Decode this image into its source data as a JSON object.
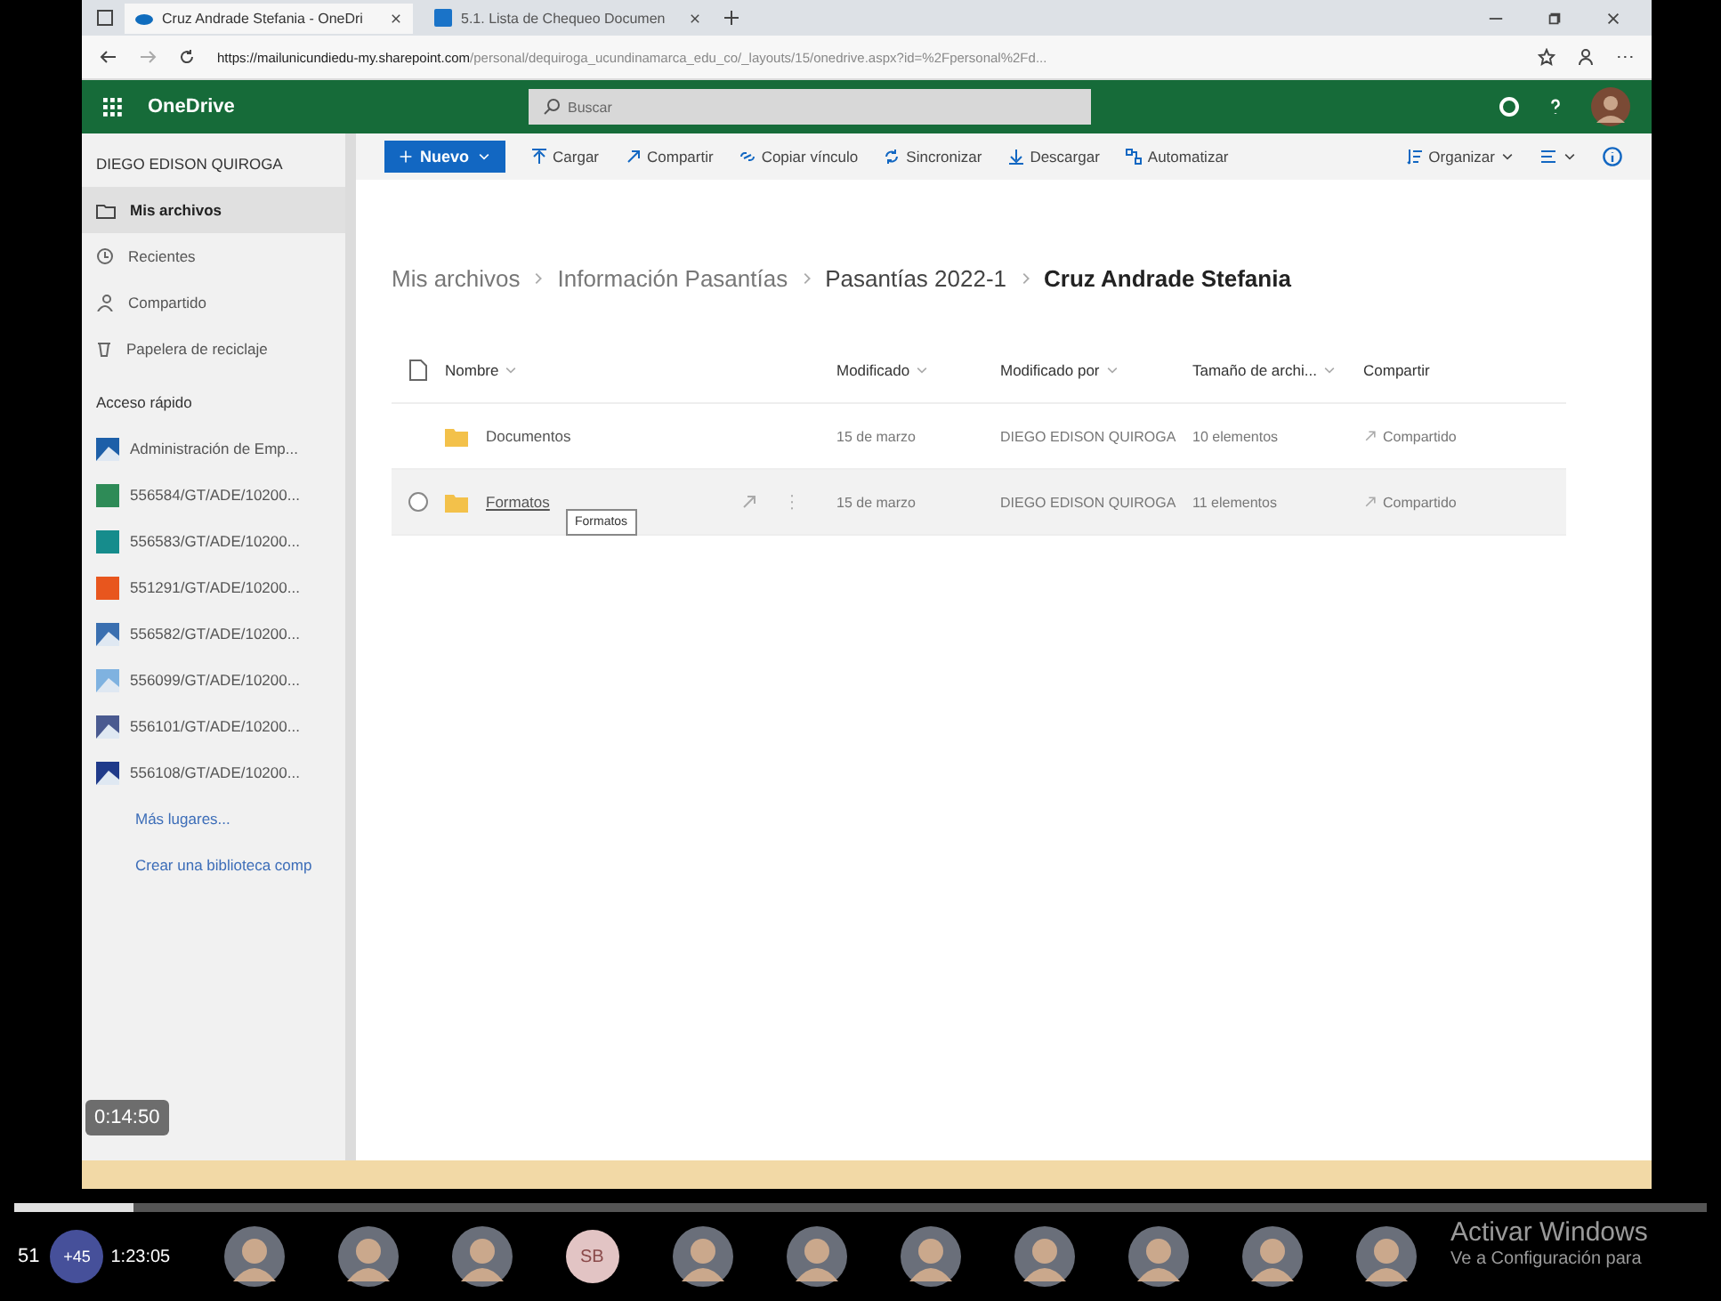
{
  "browser": {
    "tabs": [
      {
        "title": "Cruz Andrade Stefania - OneDri",
        "kind": "onedrive",
        "selected": true
      },
      {
        "title": "5.1. Lista de Chequeo Documen",
        "kind": "doc",
        "selected": false
      }
    ],
    "url_host": "https://mailunicundiedu-my.sharepoint.com",
    "url_path": "/personal/dequiroga_ucundinamarca_edu_co/_layouts/15/onedrive.aspx?id=%2Fpersonal%2Fd..."
  },
  "app": {
    "name": "OneDrive",
    "search_placeholder": "Buscar"
  },
  "sidebar": {
    "user": "DIEGO EDISON QUIROGA",
    "nav": [
      {
        "label": "Mis archivos",
        "kind": "folder",
        "selected": true
      },
      {
        "label": "Recientes",
        "kind": "clock",
        "selected": false
      },
      {
        "label": "Compartido",
        "kind": "share",
        "selected": false
      },
      {
        "label": "Papelera de reciclaje",
        "kind": "trash",
        "selected": false
      }
    ],
    "quick_access_title": "Acceso rápido",
    "quick_access": [
      {
        "label": "Administración de Emp...",
        "kind": "image",
        "color": "#1d5fa8"
      },
      {
        "label": "556584/GT/ADE/10200...",
        "kind": "site",
        "color": "#2e8b57"
      },
      {
        "label": "556583/GT/ADE/10200...",
        "kind": "site",
        "color": "#168c8c"
      },
      {
        "label": "551291/GT/ADE/10200...",
        "kind": "site",
        "color": "#e8561e"
      },
      {
        "label": "556582/GT/ADE/10200...",
        "kind": "image",
        "color": "#3a6fb0"
      },
      {
        "label": "556099/GT/ADE/10200...",
        "kind": "image",
        "color": "#7fb2e0"
      },
      {
        "label": "556101/GT/ADE/10200...",
        "kind": "image",
        "color": "#4a5a90"
      },
      {
        "label": "556108/GT/ADE/10200...",
        "kind": "image",
        "color": "#1f3a8a"
      }
    ],
    "links": [
      "Más lugares...",
      "Crear una biblioteca comp"
    ]
  },
  "commands": [
    {
      "label": "Nuevo",
      "kind": "primary"
    },
    {
      "label": "Cargar",
      "kind": "upload"
    },
    {
      "label": "Compartir",
      "kind": "share"
    },
    {
      "label": "Copiar vínculo",
      "kind": "link"
    },
    {
      "label": "Sincronizar",
      "kind": "sync"
    },
    {
      "label": "Descargar",
      "kind": "download"
    },
    {
      "label": "Automatizar",
      "kind": "flow"
    }
  ],
  "right_commands": [
    {
      "label": "Organizar",
      "kind": "sort"
    },
    {
      "kind": "view"
    }
  ],
  "breadcrumb": [
    "Mis archivos",
    "Información Pasantías",
    "Pasantías 2022-1",
    "Cruz Andrade Stefania"
  ],
  "table": {
    "columns": [
      "Nombre",
      "Modificado",
      "Modificado por",
      "Tamaño de archi...",
      "Compartir"
    ],
    "rows": [
      {
        "name": "Documentos",
        "modified": "15 de marzo",
        "modified_by": "DIEGO EDISON QUIROGA",
        "size": "10 elementos",
        "sharing": "Compartido",
        "hovered": false
      },
      {
        "name": "Formatos",
        "modified": "15 de marzo",
        "modified_by": "DIEGO EDISON QUIROGA",
        "size": "11 elementos",
        "sharing": "Compartido",
        "hovered": true
      }
    ]
  },
  "tooltip": "Formatos",
  "player": {
    "time_tooltip": "0:14:50",
    "elapsed": "1:23:05",
    "level": 0.07
  },
  "call": {
    "count": "51",
    "extra": "+45",
    "participants": [
      {
        "kind": "photo"
      },
      {
        "kind": "photo"
      },
      {
        "kind": "photo"
      },
      {
        "kind": "initials",
        "initials": "SB"
      },
      {
        "kind": "photo"
      },
      {
        "kind": "photo"
      },
      {
        "kind": "photo"
      },
      {
        "kind": "photo"
      },
      {
        "kind": "photo"
      },
      {
        "kind": "photo"
      },
      {
        "kind": "photo"
      }
    ]
  },
  "windows_notice": {
    "title": "Activar Windows",
    "subtitle": "Ve a Configuración para"
  }
}
